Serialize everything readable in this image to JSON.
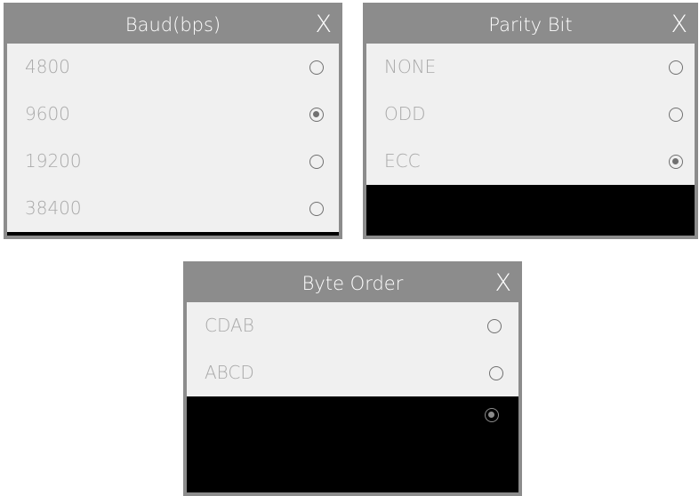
{
  "baud_dialog": {
    "title": "Baud(bps)",
    "close_label": "X",
    "options": [
      {
        "label": "4800",
        "selected": false
      },
      {
        "label": "9600",
        "selected": true
      },
      {
        "label": "19200",
        "selected": false
      },
      {
        "label": "38400",
        "selected": false
      }
    ]
  },
  "parity_dialog": {
    "title": "Parity Bit",
    "close_label": "X",
    "options": [
      {
        "label": "NONE",
        "selected": false
      },
      {
        "label": "ODD",
        "selected": false
      },
      {
        "label": "ECC",
        "selected": true
      }
    ]
  },
  "byte_order_dialog": {
    "title": "Byte Order",
    "close_label": "X",
    "options": [
      {
        "label": "CDAB",
        "selected": false
      },
      {
        "label": "ABCD",
        "selected": false
      },
      {
        "label": "",
        "selected": true
      }
    ]
  }
}
